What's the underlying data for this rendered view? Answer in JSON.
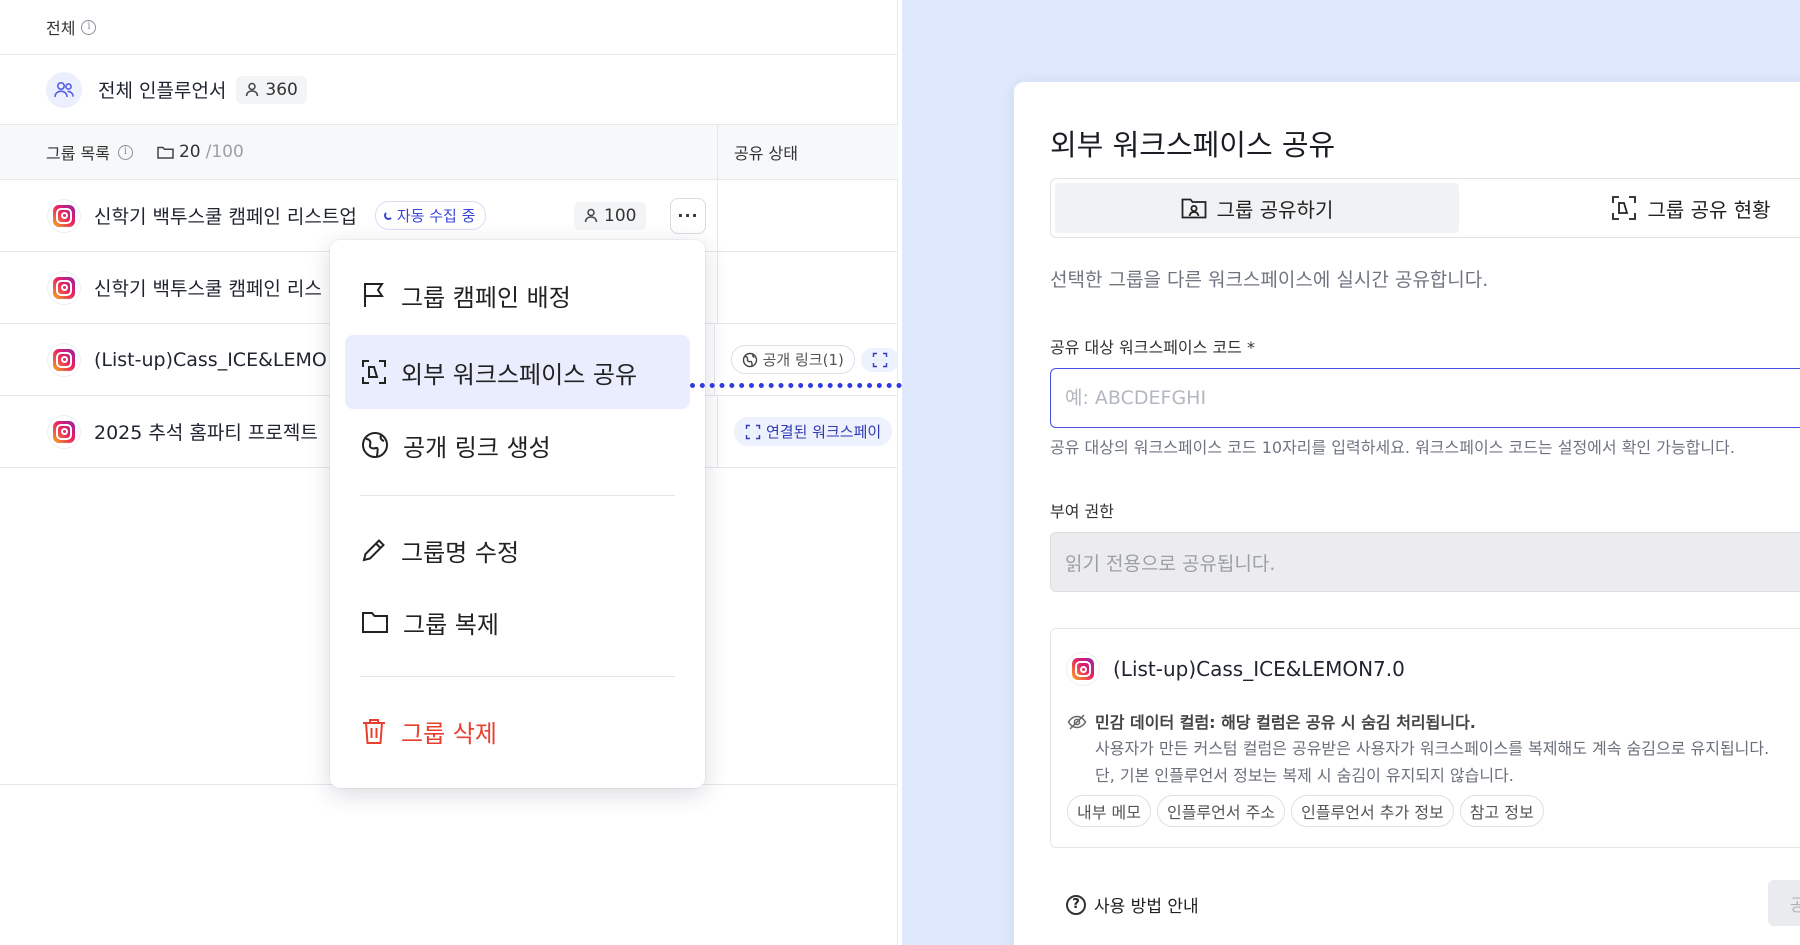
{
  "header": {
    "title": "전체"
  },
  "all_influencers": {
    "label": "전체 인플루언서",
    "count": "360"
  },
  "table": {
    "group_list_label": "그룹 목록",
    "folder_count": "20",
    "folder_max": "/100",
    "share_status_label": "공유 상태",
    "rows": [
      {
        "name": "신학기 백투스쿨 캠페인 리스트업",
        "status_chip": "자동 수집 중",
        "members": "100"
      },
      {
        "name": "신학기 백투스쿨 캠페인 리스"
      },
      {
        "name": "(List-up)Cass_ICE&LEMO",
        "share_chip": "공개 링크(1)"
      },
      {
        "name": "2025 추석 홈파티 프로젝트",
        "share_chip": "연결된 워크스페이"
      }
    ]
  },
  "menu": {
    "items": [
      {
        "label": "그룹 캠페인 배정",
        "icon": "flag-icon"
      },
      {
        "label": "외부 워크스페이스 공유",
        "icon": "share-frame-icon",
        "active": true
      },
      {
        "label": "공개 링크 생성",
        "icon": "globe-icon"
      },
      {
        "label": "그룹명 수정",
        "icon": "pencil-icon"
      },
      {
        "label": "그룹 복제",
        "icon": "folder-icon"
      },
      {
        "label": "그룹 삭제",
        "icon": "trash-icon",
        "danger": true
      }
    ]
  },
  "modal": {
    "title": "외부 워크스페이스 공유",
    "tabs": [
      "그룹 공유하기",
      "그룹 공유 현황"
    ],
    "description": "선택한 그룹을 다른 워크스페이스에 실시간 공유합니다.",
    "code_label": "공유 대상 워크스페이스 코드 *",
    "code_placeholder": "예: ABCDEFGHI",
    "code_value": "",
    "code_hint": "공유 대상의 워크스페이스 코드 10자리를 입력하세요. 워크스페이스 코드는 설정에서 확인 가능합니다.",
    "permission_label": "부여 권한",
    "permission_value": "읽기 전용으로 공유됩니다.",
    "group_name": "(List-up)Cass_ICE&LEMON7.0",
    "warning_title": "민감 데이터 컬럼: 해당 컬럼은 공유 시 숨김 처리됩니다.",
    "warning_line1": "사용자가 만든 커스텀 컬럼은 공유받은 사용자가 워크스페이스를 복제해도 계속 숨김으로 유지됩니다.",
    "warning_line2": "단, 기본 인플루언서 정보는 복제 시 숨김이 유지되지 않습니다.",
    "hidden_columns": [
      "내부 메모",
      "인플루언서 주소",
      "인플루언서 추가 정보",
      "참고 정보"
    ],
    "help_label": "사용 방법 안내",
    "submit_label": "공"
  },
  "colors": {
    "accent": "#2f3be0",
    "danger": "#e8402f",
    "right_bg": "#dfe8fc"
  }
}
